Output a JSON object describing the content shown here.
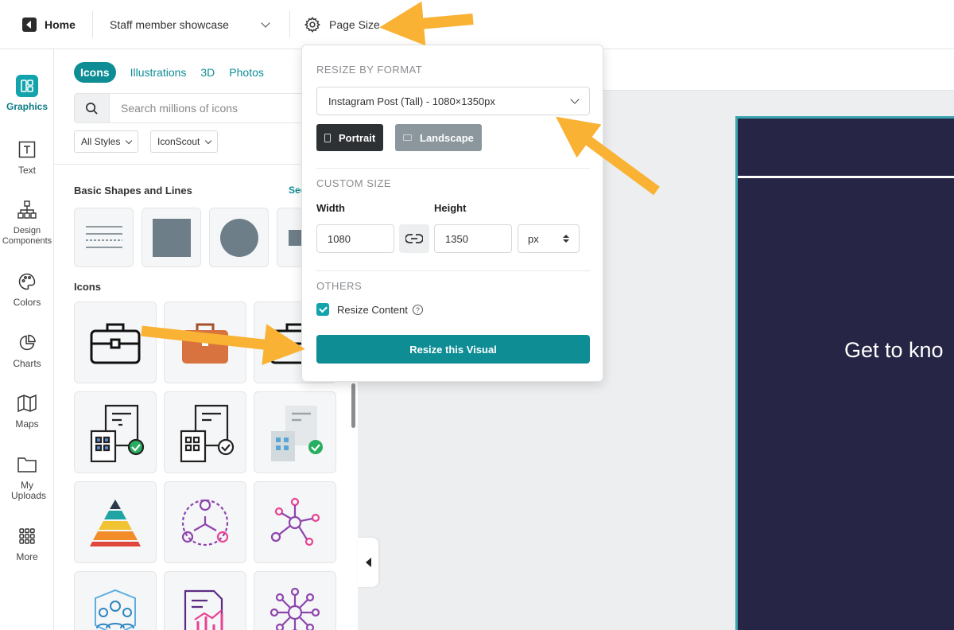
{
  "topbar": {
    "home_label": "Home",
    "project_name": "Staff member showcase",
    "page_size_label": "Page Size"
  },
  "rail": {
    "items": [
      {
        "label": "Graphics",
        "icon": "graphics-icon",
        "active": true
      },
      {
        "label": "Text",
        "icon": "text-icon"
      },
      {
        "label": "Design Components",
        "icon": "design-components-icon"
      },
      {
        "label": "Colors",
        "icon": "palette-icon"
      },
      {
        "label": "Charts",
        "icon": "pie-chart-icon"
      },
      {
        "label": "Maps",
        "icon": "map-icon"
      },
      {
        "label": "My Uploads",
        "icon": "folder-icon"
      },
      {
        "label": "More",
        "icon": "grid-icon"
      }
    ]
  },
  "panel": {
    "tabs": [
      "Icons",
      "Illustrations",
      "3D",
      "Photos"
    ],
    "active_tab": "Icons",
    "search_placeholder": "Search millions of icons",
    "filters": [
      "All Styles",
      "IconScout"
    ],
    "basic_shapes_title": "Basic Shapes and Lines",
    "see_all_label": "See",
    "icons_title": "Icons"
  },
  "canvas": {
    "artboard_text": "Get to kno",
    "artboard_color": "#262545",
    "artboard_border": "#3ba6b0"
  },
  "popover": {
    "resize_by_format_label": "RESIZE BY FORMAT",
    "format_value": "Instagram Post (Tall) - 1080×1350px",
    "portrait_label": "Portrait",
    "landscape_label": "Landscape",
    "custom_size_label": "CUSTOM SIZE",
    "width_label": "Width",
    "height_label": "Height",
    "width_value": "1080",
    "height_value": "1350",
    "unit_value": "px",
    "others_label": "OTHERS",
    "resize_content_label": "Resize Content",
    "resize_content_checked": true,
    "resize_button_label": "Resize this Visual"
  },
  "colors": {
    "accent": "#0e8d95",
    "annotation_arrow": "#f9b233"
  }
}
